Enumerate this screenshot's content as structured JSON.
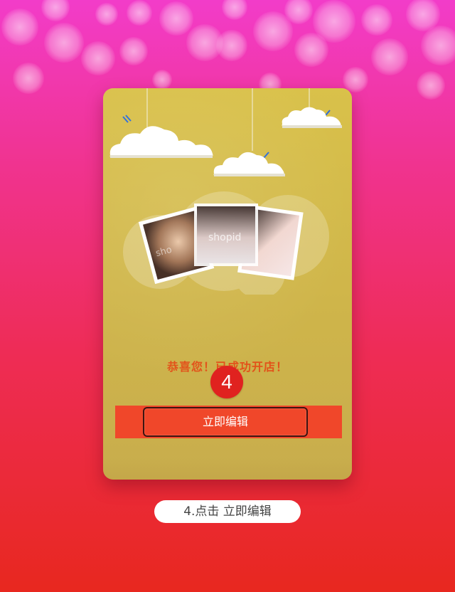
{
  "card": {
    "congrats_text": "恭喜您！已成功开店！",
    "step_number": "4",
    "button_label": "立即编辑",
    "photo_watermark_left": "sho",
    "photo_watermark_center": "shopid"
  },
  "caption": {
    "text": "4.点击 立即编辑"
  },
  "colors": {
    "background_top": "#f23cc9",
    "background_bottom": "#e8281f",
    "card": "#d9c14a",
    "button": "#f0472a",
    "badge": "#e0221f",
    "congrats_text": "#e25219"
  }
}
